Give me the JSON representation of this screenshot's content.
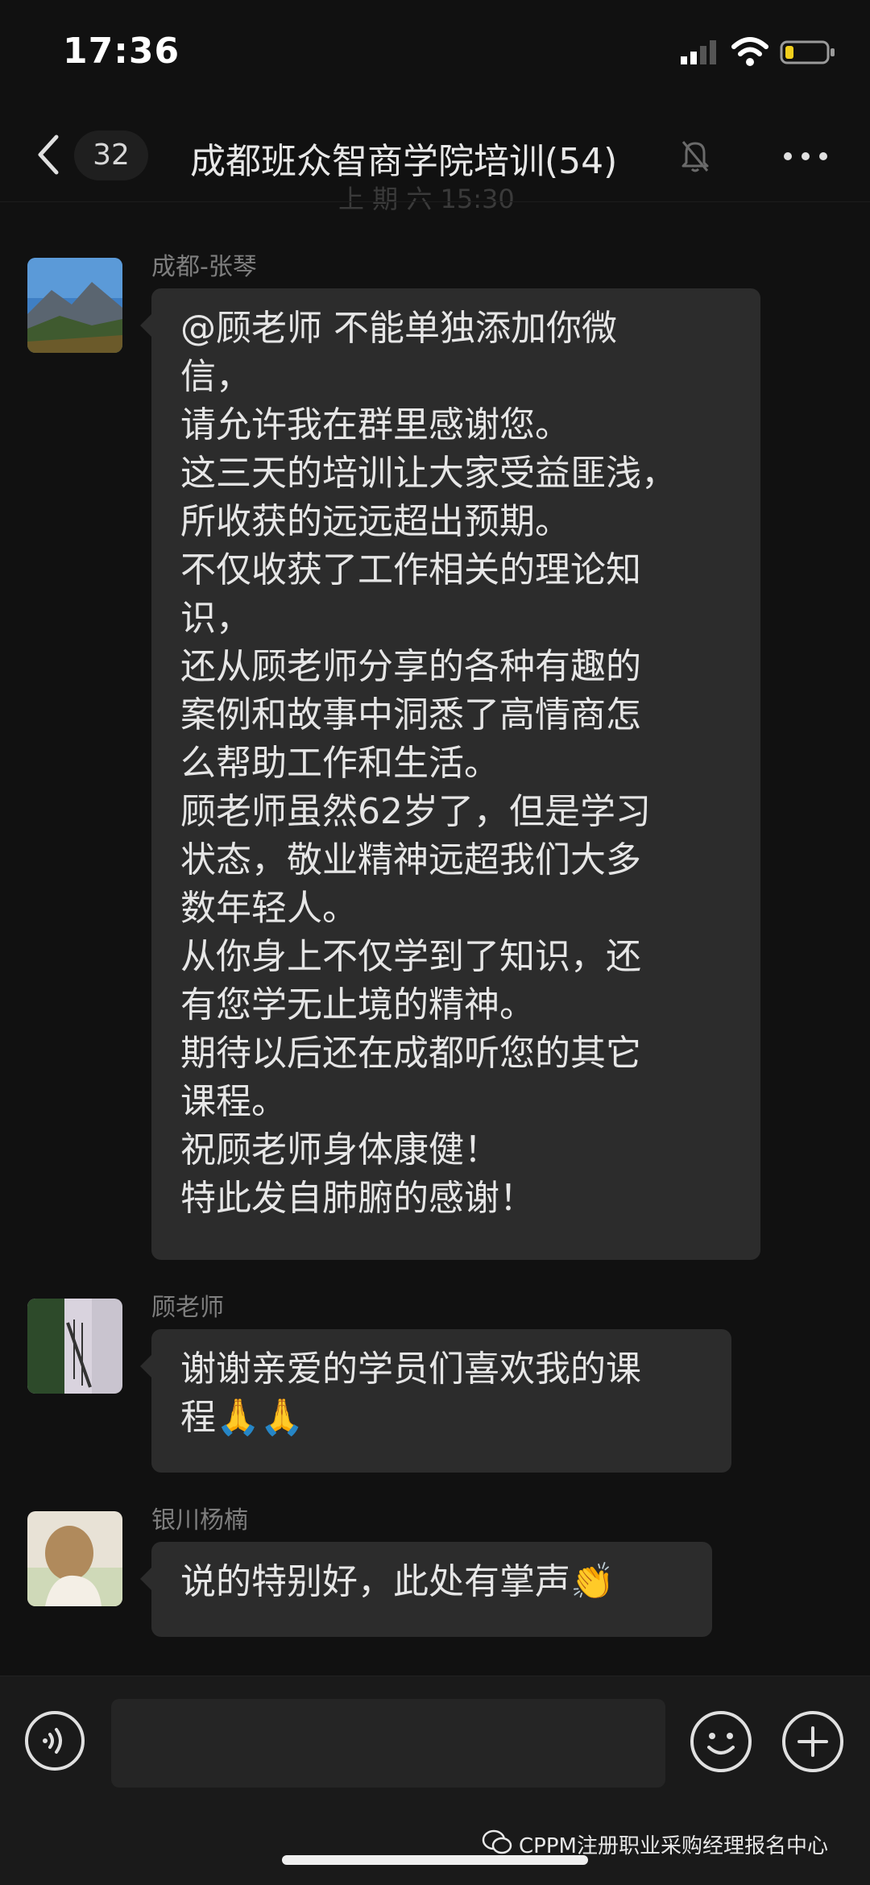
{
  "status": {
    "time": "17:36"
  },
  "header": {
    "unread_count": "32",
    "title": "成都班众智商学院培训(54)",
    "ghost_time": "上 期 六 15:30"
  },
  "messages": [
    {
      "sender": "成都-张琴",
      "text": "@顾老师 不能单独添加你微\n信，\n请允许我在群里感谢您。\n这三天的培训让大家受益匪浅，\n所收获的远远超出预期。\n不仅收获了工作相关的理论知\n识，\n还从顾老师分享的各种有趣的\n案例和故事中洞悉了高情商怎\n么帮助工作和生活。\n顾老师虽然62岁了，但是学习\n状态，敬业精神远超我们大多\n数年轻人。\n从你身上不仅学到了知识，还\n有您学无止境的精神。\n期待以后还在成都听您的其它\n课程。\n祝顾老师身体康健！\n特此发自肺腑的感谢！"
    },
    {
      "sender": "顾老师",
      "text": "谢谢亲爱的学员们喜欢我的课\n程🙏🙏"
    },
    {
      "sender": "银川杨楠",
      "text": "说的特别好，此处有掌声👏"
    }
  ],
  "footer": {
    "watermark": "CPPM注册职业采购经理报名中心"
  },
  "icons": [
    "signal-icon",
    "wifi-icon",
    "battery-icon",
    "back-icon",
    "mute-icon",
    "more-icon",
    "voice-icon",
    "emoji-icon",
    "plus-icon",
    "wechat-icon"
  ]
}
